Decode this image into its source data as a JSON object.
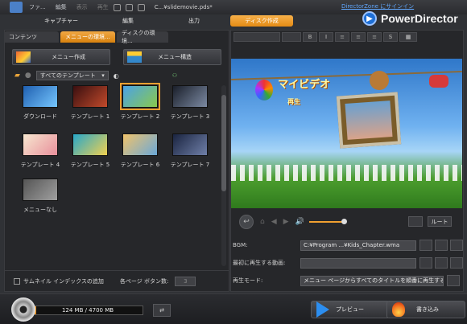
{
  "titlebar": {
    "menu": [
      "ファ...",
      "編集",
      "表示",
      "再生"
    ],
    "file_title": "C...¥slidemovie.pds*",
    "directorzone_link": "DirectorZone にサインイン",
    "brand": "PowerDirector"
  },
  "modes": {
    "capture": "キャプチャー",
    "edit": "編集",
    "output": "出力",
    "disc": "ディスク作成",
    "active": "ディスク作成"
  },
  "left": {
    "tabs": [
      "コンテンツ",
      "メニューの環境...",
      "ディスクの環境..."
    ],
    "active_tab": "メニューの環境...",
    "create_menu_label": "メニュー作成",
    "menu_structure_label": "メニュー構造",
    "filter_value": "すべてのテンプレート",
    "templates": [
      {
        "label": "ダウンロード",
        "colors": [
          "#1f5fb0",
          "#76c7ff"
        ]
      },
      {
        "label": "テンプレート 1",
        "colors": [
          "#3a0f10",
          "#c24a2b"
        ]
      },
      {
        "label": "テンプレート 2",
        "colors": [
          "#4aa2e8",
          "#89c94c"
        ]
      },
      {
        "label": "テンプレート 3",
        "colors": [
          "#1a1f2a",
          "#7c8aa3"
        ]
      },
      {
        "label": "テンプレート 4",
        "colors": [
          "#f7e7d0",
          "#e88f9b"
        ]
      },
      {
        "label": "テンプレート 5",
        "colors": [
          "#27a7c9",
          "#f0d050"
        ]
      },
      {
        "label": "テンプレート 6",
        "colors": [
          "#f1c36b",
          "#6aa8d8"
        ]
      },
      {
        "label": "テンプレート 7",
        "colors": [
          "#1a2440",
          "#6f7fa8"
        ]
      },
      {
        "label": "メニューなし",
        "colors": [
          "#555555",
          "#a0a0a0"
        ]
      }
    ],
    "selected_template": "テンプレート 2",
    "thumbnail_index_label": "サムネイル インデックスの追加",
    "buttons_per_page_label": "各ページ ボタン数:",
    "buttons_per_page_value": "3"
  },
  "preview": {
    "title": "マイビデオ",
    "play": "再生"
  },
  "controls": {
    "route_label": "ルート",
    "volume_level": 0.85
  },
  "properties": {
    "bgm_label": "BGM:",
    "bgm_value": "C:¥Program ...¥Kids_Chapter.wma",
    "first_play_label": "最初に再生する動画:",
    "first_play_value": "",
    "play_mode_label": "再生モード:",
    "play_mode_value": "メニュー ページからすべてのタイトルを順番に再生する"
  },
  "bottom": {
    "capacity_text": "124 MB / 4700 MB",
    "capacity_used_fraction": 0.026,
    "preview_label": "プレビュー",
    "burn_label": "書き込み"
  }
}
